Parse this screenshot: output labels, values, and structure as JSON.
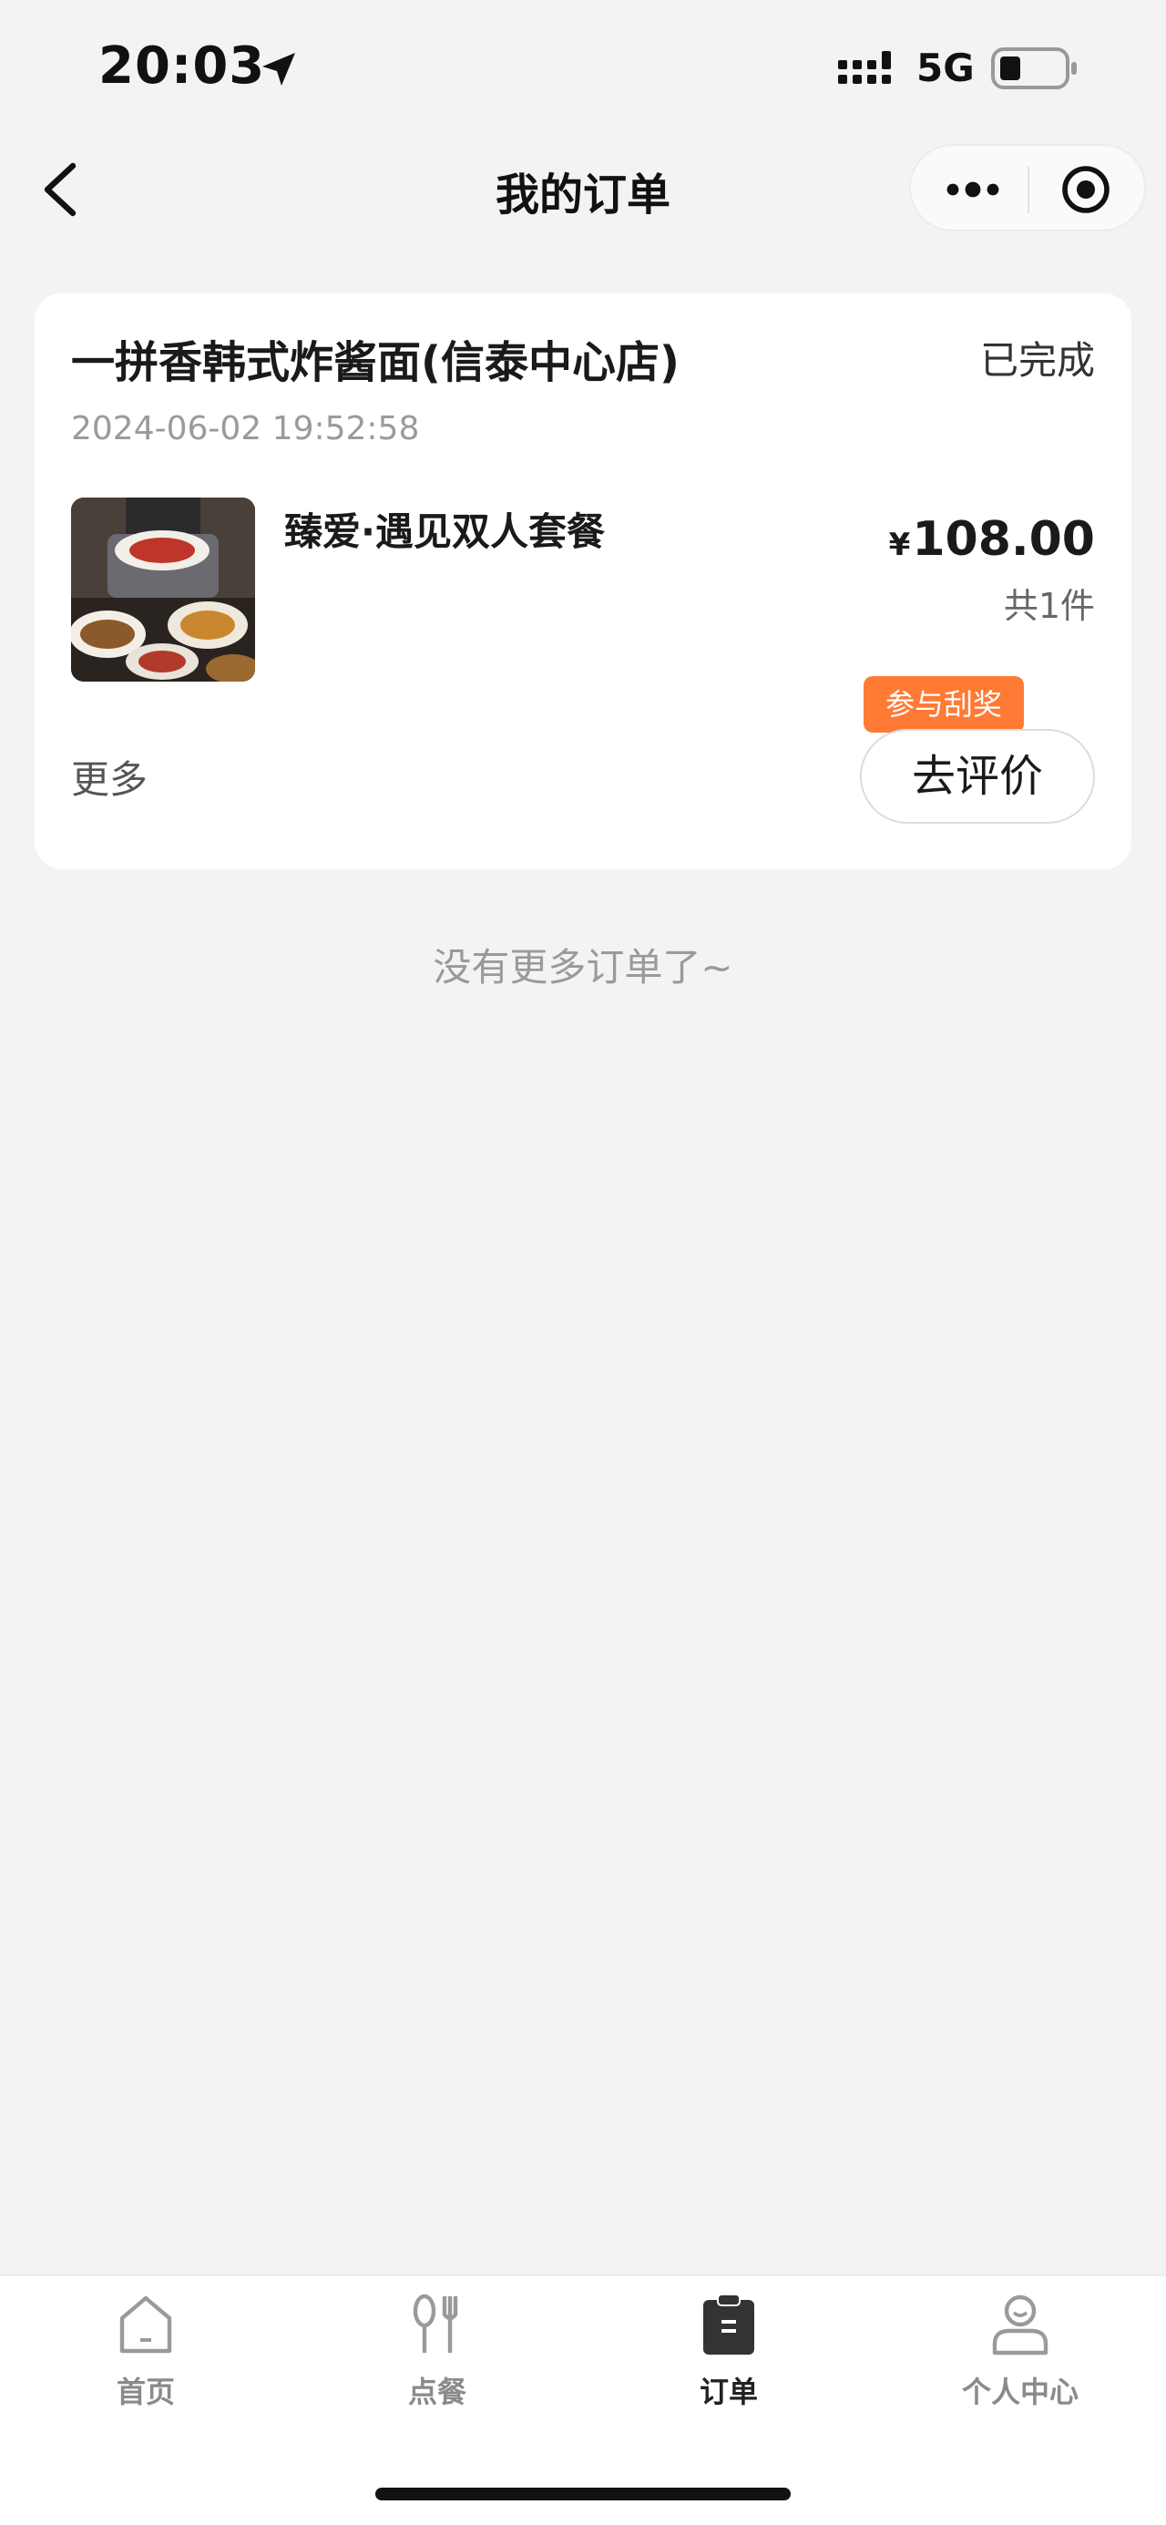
{
  "status_bar": {
    "time": "20:03",
    "network": "5G"
  },
  "nav": {
    "title": "我的订单"
  },
  "order": {
    "store": "一拼香韩式炸酱面(信泰中心店)",
    "status": "已完成",
    "datetime": "2024-06-02 19:52:58",
    "item_name": "臻爱·遇见双人套餐",
    "currency": "¥",
    "price": "108.00",
    "count": "共1件",
    "more_label": "更多",
    "lottery_tag": "参与刮奖",
    "review_label": "去评价"
  },
  "footer_note": "没有更多订单了~",
  "tabs": [
    {
      "label": "首页",
      "icon": "home-icon"
    },
    {
      "label": "点餐",
      "icon": "utensils-icon"
    },
    {
      "label": "订单",
      "icon": "clipboard-icon"
    },
    {
      "label": "个人中心",
      "icon": "user-icon"
    }
  ],
  "active_tab": "订单",
  "colors": {
    "accent": "#ff7a34",
    "background": "#f3f3f3"
  }
}
